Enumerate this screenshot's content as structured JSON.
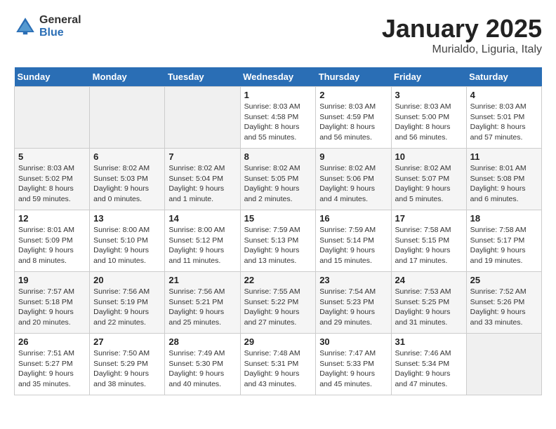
{
  "header": {
    "logo_general": "General",
    "logo_blue": "Blue",
    "month": "January 2025",
    "location": "Murialdo, Liguria, Italy"
  },
  "days_of_week": [
    "Sunday",
    "Monday",
    "Tuesday",
    "Wednesday",
    "Thursday",
    "Friday",
    "Saturday"
  ],
  "weeks": [
    [
      {
        "day": "",
        "info": ""
      },
      {
        "day": "",
        "info": ""
      },
      {
        "day": "",
        "info": ""
      },
      {
        "day": "1",
        "info": "Sunrise: 8:03 AM\nSunset: 4:58 PM\nDaylight: 8 hours\nand 55 minutes."
      },
      {
        "day": "2",
        "info": "Sunrise: 8:03 AM\nSunset: 4:59 PM\nDaylight: 8 hours\nand 56 minutes."
      },
      {
        "day": "3",
        "info": "Sunrise: 8:03 AM\nSunset: 5:00 PM\nDaylight: 8 hours\nand 56 minutes."
      },
      {
        "day": "4",
        "info": "Sunrise: 8:03 AM\nSunset: 5:01 PM\nDaylight: 8 hours\nand 57 minutes."
      }
    ],
    [
      {
        "day": "5",
        "info": "Sunrise: 8:03 AM\nSunset: 5:02 PM\nDaylight: 8 hours\nand 59 minutes."
      },
      {
        "day": "6",
        "info": "Sunrise: 8:02 AM\nSunset: 5:03 PM\nDaylight: 9 hours\nand 0 minutes."
      },
      {
        "day": "7",
        "info": "Sunrise: 8:02 AM\nSunset: 5:04 PM\nDaylight: 9 hours\nand 1 minute."
      },
      {
        "day": "8",
        "info": "Sunrise: 8:02 AM\nSunset: 5:05 PM\nDaylight: 9 hours\nand 2 minutes."
      },
      {
        "day": "9",
        "info": "Sunrise: 8:02 AM\nSunset: 5:06 PM\nDaylight: 9 hours\nand 4 minutes."
      },
      {
        "day": "10",
        "info": "Sunrise: 8:02 AM\nSunset: 5:07 PM\nDaylight: 9 hours\nand 5 minutes."
      },
      {
        "day": "11",
        "info": "Sunrise: 8:01 AM\nSunset: 5:08 PM\nDaylight: 9 hours\nand 6 minutes."
      }
    ],
    [
      {
        "day": "12",
        "info": "Sunrise: 8:01 AM\nSunset: 5:09 PM\nDaylight: 9 hours\nand 8 minutes."
      },
      {
        "day": "13",
        "info": "Sunrise: 8:00 AM\nSunset: 5:10 PM\nDaylight: 9 hours\nand 10 minutes."
      },
      {
        "day": "14",
        "info": "Sunrise: 8:00 AM\nSunset: 5:12 PM\nDaylight: 9 hours\nand 11 minutes."
      },
      {
        "day": "15",
        "info": "Sunrise: 7:59 AM\nSunset: 5:13 PM\nDaylight: 9 hours\nand 13 minutes."
      },
      {
        "day": "16",
        "info": "Sunrise: 7:59 AM\nSunset: 5:14 PM\nDaylight: 9 hours\nand 15 minutes."
      },
      {
        "day": "17",
        "info": "Sunrise: 7:58 AM\nSunset: 5:15 PM\nDaylight: 9 hours\nand 17 minutes."
      },
      {
        "day": "18",
        "info": "Sunrise: 7:58 AM\nSunset: 5:17 PM\nDaylight: 9 hours\nand 19 minutes."
      }
    ],
    [
      {
        "day": "19",
        "info": "Sunrise: 7:57 AM\nSunset: 5:18 PM\nDaylight: 9 hours\nand 20 minutes."
      },
      {
        "day": "20",
        "info": "Sunrise: 7:56 AM\nSunset: 5:19 PM\nDaylight: 9 hours\nand 22 minutes."
      },
      {
        "day": "21",
        "info": "Sunrise: 7:56 AM\nSunset: 5:21 PM\nDaylight: 9 hours\nand 25 minutes."
      },
      {
        "day": "22",
        "info": "Sunrise: 7:55 AM\nSunset: 5:22 PM\nDaylight: 9 hours\nand 27 minutes."
      },
      {
        "day": "23",
        "info": "Sunrise: 7:54 AM\nSunset: 5:23 PM\nDaylight: 9 hours\nand 29 minutes."
      },
      {
        "day": "24",
        "info": "Sunrise: 7:53 AM\nSunset: 5:25 PM\nDaylight: 9 hours\nand 31 minutes."
      },
      {
        "day": "25",
        "info": "Sunrise: 7:52 AM\nSunset: 5:26 PM\nDaylight: 9 hours\nand 33 minutes."
      }
    ],
    [
      {
        "day": "26",
        "info": "Sunrise: 7:51 AM\nSunset: 5:27 PM\nDaylight: 9 hours\nand 35 minutes."
      },
      {
        "day": "27",
        "info": "Sunrise: 7:50 AM\nSunset: 5:29 PM\nDaylight: 9 hours\nand 38 minutes."
      },
      {
        "day": "28",
        "info": "Sunrise: 7:49 AM\nSunset: 5:30 PM\nDaylight: 9 hours\nand 40 minutes."
      },
      {
        "day": "29",
        "info": "Sunrise: 7:48 AM\nSunset: 5:31 PM\nDaylight: 9 hours\nand 43 minutes."
      },
      {
        "day": "30",
        "info": "Sunrise: 7:47 AM\nSunset: 5:33 PM\nDaylight: 9 hours\nand 45 minutes."
      },
      {
        "day": "31",
        "info": "Sunrise: 7:46 AM\nSunset: 5:34 PM\nDaylight: 9 hours\nand 47 minutes."
      },
      {
        "day": "",
        "info": ""
      }
    ]
  ]
}
